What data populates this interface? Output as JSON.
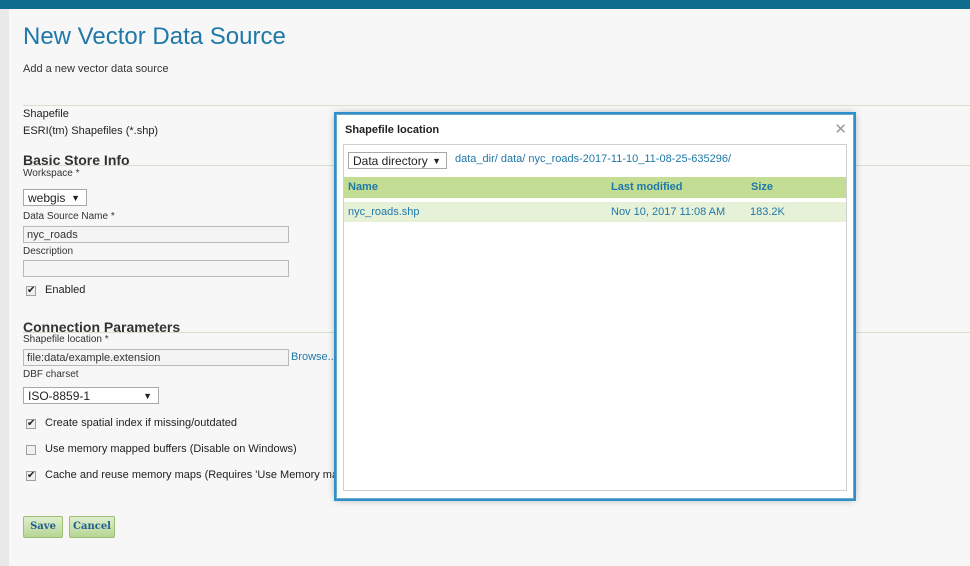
{
  "page": {
    "title": "New Vector Data Source",
    "subtitle": "Add a new vector data source"
  },
  "store_type": {
    "name": "Shapefile",
    "description": "ESRI(tm) Shapefiles (*.shp)"
  },
  "basic_store_info": {
    "heading": "Basic Store Info",
    "workspace_label": "Workspace *",
    "workspace_value": "webgis",
    "data_source_name_label": "Data Source Name *",
    "data_source_name_value": "nyc_roads",
    "description_label": "Description",
    "description_value": "",
    "enabled_label": "Enabled"
  },
  "connection_parameters": {
    "heading": "Connection Parameters",
    "shapefile_location_label": "Shapefile location *",
    "shapefile_location_value": "file:data/example.extension",
    "browse_label": "Browse...",
    "dbf_charset_label": "DBF charset",
    "dbf_charset_value": "ISO-8859-1",
    "create_spatial_index_label": "Create spatial index if missing/outdated",
    "memory_mapped_label": "Use memory mapped buffers (Disable on Windows)",
    "cache_memory_maps_label": "Cache and reuse memory maps (Requires 'Use Memory mapped b"
  },
  "actions": {
    "save_label": "Save",
    "cancel_label": "Cancel"
  },
  "dialog": {
    "title": "Shapefile location",
    "close_glyph": "✕",
    "root_select": "Data directory",
    "breadcrumb": "data_dir/ data/ nyc_roads-2017-11-10_11-08-25-635296/",
    "columns": {
      "name": "Name",
      "last_modified": "Last modified",
      "size": "Size"
    },
    "rows": [
      {
        "name": "nyc_roads.shp",
        "last_modified": "Nov 10, 2017 11:08 AM",
        "size": "183.2K"
      }
    ]
  },
  "icons": {
    "dropdown": "chevron-down-icon",
    "close": "close-icon",
    "checkbox_checked": "check-icon"
  },
  "colors": {
    "accent": "#1f78a8",
    "header_bar": "#0e6d8f",
    "table_header": "#c4dd95",
    "table_row": "#e7f1d8",
    "button": "#b6d593"
  }
}
